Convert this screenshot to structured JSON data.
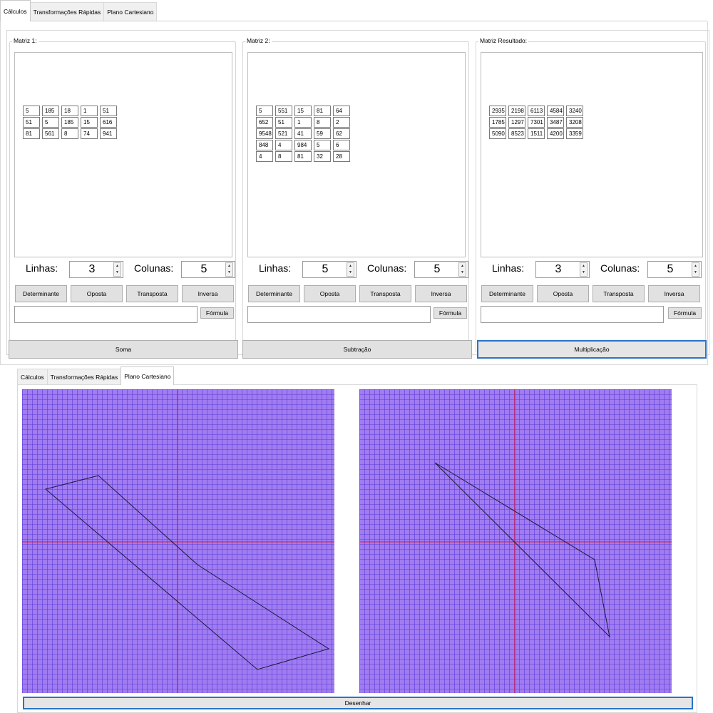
{
  "tabs": [
    "Cálculos",
    "Transformações Rápidas",
    "Plano Cartesiano"
  ],
  "matrices": [
    {
      "title": "Matriz 1:",
      "rows": 3,
      "cols": 5,
      "cells": [
        [
          "5",
          "185",
          "18",
          "1",
          "51"
        ],
        [
          "51",
          "5",
          "185",
          "15",
          "616"
        ],
        [
          "81",
          "561",
          "8",
          "74",
          "941"
        ]
      ]
    },
    {
      "title": "Matriz 2:",
      "rows": 5,
      "cols": 5,
      "cells": [
        [
          "5",
          "551",
          "15",
          "81",
          "64"
        ],
        [
          "652",
          "51",
          "1",
          "8",
          "2"
        ],
        [
          "9548",
          "521",
          "41",
          "59",
          "62"
        ],
        [
          "848",
          "4",
          "984",
          "5",
          "6"
        ],
        [
          "4",
          "8",
          "81",
          "32",
          "28"
        ]
      ]
    },
    {
      "title": "Matriz Resultado:",
      "rows": 3,
      "cols": 5,
      "cells": [
        [
          "2935",
          "2198",
          "6113",
          "4584",
          "3240"
        ],
        [
          "1785",
          "1297",
          "7301",
          "3487",
          "3208"
        ],
        [
          "5090",
          "8523",
          "1511",
          "4200",
          "3359"
        ]
      ]
    }
  ],
  "labels": {
    "linhas": "Linhas:",
    "colunas": "Colunas:"
  },
  "matrix_buttons": [
    "Determinante",
    "Oposta",
    "Transposta",
    "Inversa"
  ],
  "formula_button": "Fórmula",
  "operation_buttons": [
    "Soma",
    "Subtração",
    "Multiplicação"
  ],
  "draw_button": "Desenhar",
  "colors": {
    "plane_bg": "#a07cf0",
    "grid_line": "#5a3cd8",
    "axis": "#e8132d",
    "shape": "#1a1a3a",
    "focus": "#2a74c7"
  }
}
